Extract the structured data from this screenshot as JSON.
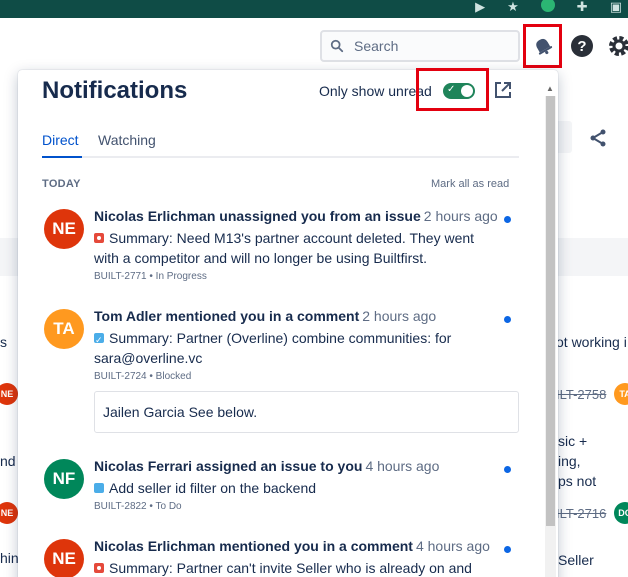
{
  "header": {
    "search_placeholder": "Search"
  },
  "background": {
    "fragments": [
      {
        "text": "ot working i"
      },
      {
        "text": "sic +"
      },
      {
        "text": "ing,"
      },
      {
        "text": "ps not"
      },
      {
        "text": "Seller"
      },
      {
        "text": "s"
      },
      {
        "text": "nd"
      },
      {
        "text": "hin"
      }
    ],
    "keys": [
      "ILT-2758",
      "ILT-2716"
    ],
    "avatars": [
      "NE",
      "TA",
      "NE",
      "DO",
      "NE"
    ]
  },
  "panel": {
    "title": "Notifications",
    "unread_label": "Only show unread",
    "tabs": [
      {
        "label": "Direct"
      },
      {
        "label": "Watching"
      }
    ],
    "section_label": "TODAY",
    "mark_all_read": "Mark all as read",
    "notifications": [
      {
        "initials": "NE",
        "avatar_color": "#de350b",
        "who": "Nicolas Erlichman unassigned you from an issue",
        "when": "2 hours ago",
        "summary": "Summary: Need M13's partner account deleted. They went with a competitor and will no longer be using Builtfirst.",
        "meta": "BUILT-2771 • In Progress"
      },
      {
        "initials": "TA",
        "avatar_color": "#ff991f",
        "who": "Tom Adler mentioned you in a comment",
        "when": "2 hours ago",
        "summary": "Summary: Partner (Overline) combine communities: for sara@overline.vc",
        "meta": "BUILT-2724 • Blocked",
        "quote": "Jailen Garcia See below."
      },
      {
        "initials": "NF",
        "avatar_color": "#00875a",
        "who": "Nicolas Ferrari assigned an issue to you",
        "when": "4 hours ago",
        "summary": "Add seller id filter on the backend",
        "meta": "BUILT-2822 • To Do"
      },
      {
        "initials": "NE",
        "avatar_color": "#de350b",
        "who": "Nicolas Erlichman mentioned you in a comment",
        "when": "4 hours ago",
        "summary": "Summary: Partner can't invite Seller who is already on and"
      }
    ]
  }
}
